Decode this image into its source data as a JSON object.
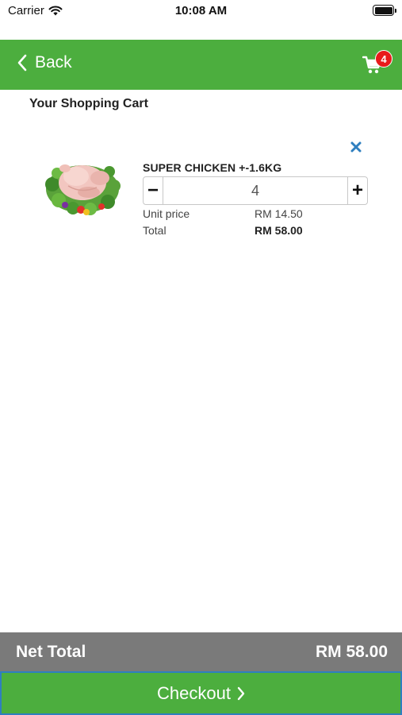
{
  "status_bar": {
    "carrier": "Carrier",
    "time": "10:08 AM",
    "icons": [
      "wifi-icon",
      "battery-icon"
    ]
  },
  "header": {
    "back_label": "Back",
    "cart_badge_count": "4",
    "background_color": "#4cae3e",
    "badge_color": "#e81b1b",
    "icons": [
      "chevron-left-icon",
      "cart-icon"
    ]
  },
  "page": {
    "title": "Your Shopping Cart"
  },
  "cart_items": [
    {
      "name": "SUPER CHICKEN +-1.6KG",
      "quantity": "4",
      "minus_label": "−",
      "plus_label": "+",
      "unit_price_label": "Unit price",
      "unit_price": "RM 14.50",
      "total_label": "Total",
      "total": "RM 58.00",
      "remove_icon": "close-icon",
      "remove_icon_color": "#2f7fbf"
    }
  ],
  "footer": {
    "net_total_label": "Net Total",
    "net_total_value": "RM 58.00",
    "checkout_label": "Checkout",
    "net_bar_color": "#7a7a7a",
    "checkout_color": "#4cae3e",
    "icons": [
      "chevron-right-icon"
    ]
  }
}
